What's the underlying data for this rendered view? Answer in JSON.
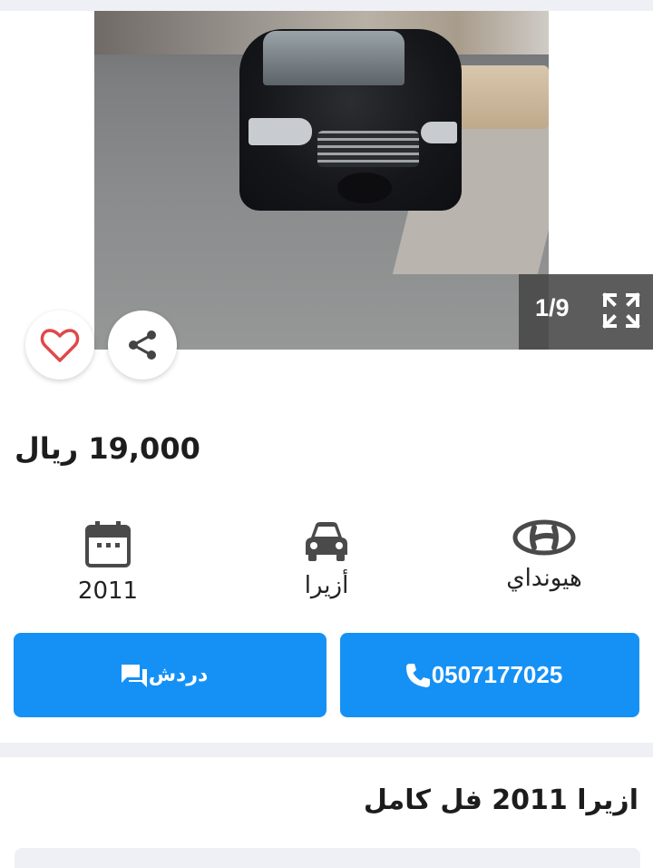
{
  "gallery": {
    "counter": "1/9",
    "prev_icon": "chevron-left-icon",
    "next_icon": "chevron-right-icon",
    "expand_icon": "expand-icon"
  },
  "listing": {
    "price": "19,000 ريال",
    "title": "ازيرا 2011 فل كامل"
  },
  "specs": {
    "year": "2011",
    "model": "أزيرا",
    "brand": "هيونداي"
  },
  "actions": {
    "chat_label": "دردش",
    "phone_number": "0507177025"
  },
  "colors": {
    "accent": "#1591f5",
    "heart": "#e0484b",
    "background": "#eef0f5"
  }
}
